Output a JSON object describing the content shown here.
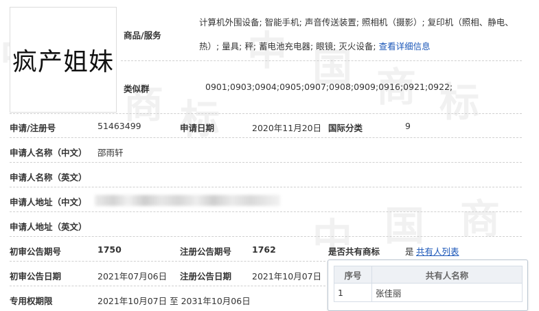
{
  "trademark": {
    "logo_text": "疯产姐妹",
    "goods_label": "商品/服务",
    "goods_line1": "计算机外围设备; 智能手机; 声音传送装置; 照相机（摄影）; 复印机（照相、静电、",
    "goods_line2": "热）; 量具; 秤; 蓄电池充电器; 眼镜; 灭火设备;",
    "goods_link": "查看详细信息",
    "similar_label": "类似群",
    "similar_value": "0901;0903;0904;0905;0907;0908;0909;0916;0921;0922;"
  },
  "fields": {
    "reg_no_label": "申请/注册号",
    "reg_no": "51463499",
    "apply_date_label": "申请日期",
    "apply_date": "2020年11月20日",
    "intl_class_label": "国际分类",
    "intl_class": "9",
    "applicant_cn_label": "申请人名称（中文）",
    "applicant_cn": "邵雨轩",
    "applicant_en_label": "申请人名称（英文）",
    "address_cn_label": "申请人地址（中文）",
    "address_en_label": "申请人地址（英文）",
    "prelim_no_label": "初审公告期号",
    "prelim_no": "1750",
    "reg_pub_no_label": "注册公告期号",
    "reg_pub_no": "1762",
    "shared_label": "是否共有商标",
    "shared_value": "是",
    "shared_link": "共有人列表",
    "prelim_date_label": "初审公告日期",
    "prelim_date": "2021年07月06日",
    "reg_pub_date_label": "注册公告日期",
    "reg_pub_date": "2021年10月07日",
    "exclusive_label": "专用权期限",
    "exclusive_value": "2021年10月07日 至 2031年10月06日"
  },
  "owners": {
    "col_no": "序号",
    "col_name": "共有人名称",
    "rows": [
      {
        "no": "1",
        "name": "张佳丽"
      }
    ]
  },
  "watermark": {
    "chars": [
      "中",
      "国",
      "商",
      "标"
    ]
  }
}
